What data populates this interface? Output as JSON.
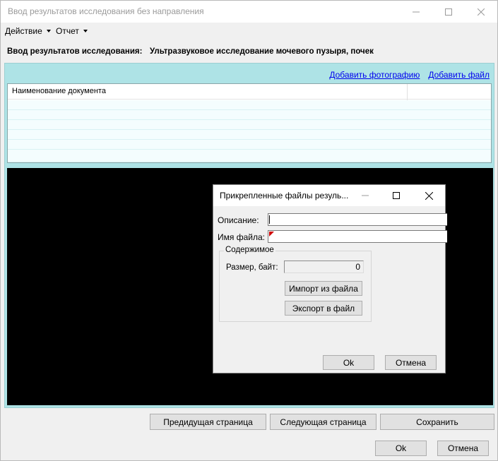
{
  "window": {
    "title": "Ввод результатов исследования без направления"
  },
  "menu": {
    "action_label": "Действие",
    "report_label": "Отчет"
  },
  "header": {
    "label": "Ввод результатов исследования:",
    "study_name": "Ультразвуковое исследование мочевого пузыря, почек"
  },
  "links": {
    "add_photo": "Добавить фотографию",
    "add_file": "Добавить файл"
  },
  "doc_table": {
    "column_name": "Наименование документа"
  },
  "bottom_buttons": {
    "prev_page": "Предидущая страница",
    "next_page": "Следующая страница",
    "save": "Сохранить",
    "ok": "Ok",
    "cancel": "Отмена"
  },
  "dialog": {
    "title": "Прикрепленные файлы резуль...",
    "description_label": "Описание:",
    "description_value": "",
    "filename_label": "Имя файла:",
    "filename_value": "",
    "group_label": "Содержимое",
    "size_label": "Размер, байт:",
    "size_value": "0",
    "import_button": "Импорт из файла",
    "export_button": "Экспорт в файл",
    "ok_button": "Ok",
    "cancel_button": "Отмена"
  }
}
